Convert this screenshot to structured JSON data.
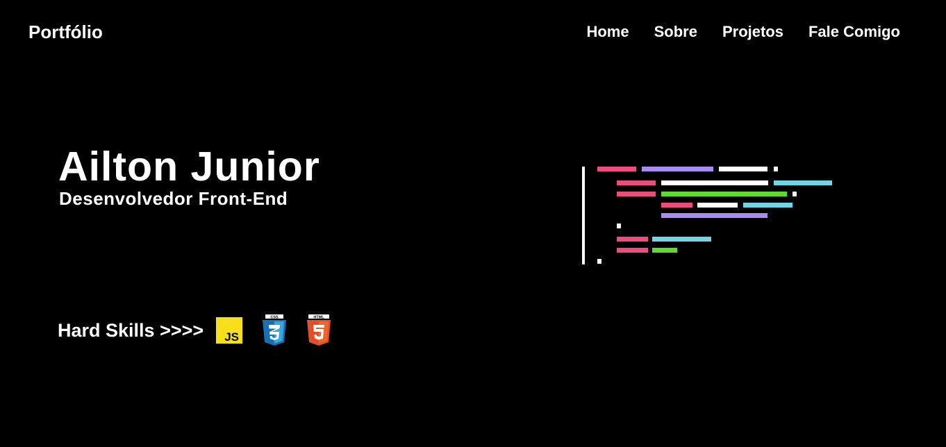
{
  "header": {
    "brand": "Portfólio",
    "nav": [
      {
        "label": "Home"
      },
      {
        "label": "Sobre"
      },
      {
        "label": "Projetos"
      },
      {
        "label": "Fale Comigo"
      }
    ]
  },
  "hero": {
    "name": "Ailton Junior",
    "role": "Desenvolvedor Front-End"
  },
  "skills": {
    "label": "Hard Skills >>>>",
    "icons": [
      {
        "icon": "javascript-icon",
        "text": "JS",
        "color": "#f7df1e"
      },
      {
        "icon": "css3-icon",
        "text": "CSS",
        "color": "#1572b6"
      },
      {
        "icon": "html5-icon",
        "text": "HTML",
        "color": "#e34f26"
      }
    ]
  },
  "code_art": {
    "icon": "code-illustration",
    "colors": {
      "pink": "#ee4b7e",
      "purple": "#a98cf0",
      "white": "#ffffff",
      "cyan": "#6fd6ea",
      "green": "#5edb2c"
    }
  }
}
